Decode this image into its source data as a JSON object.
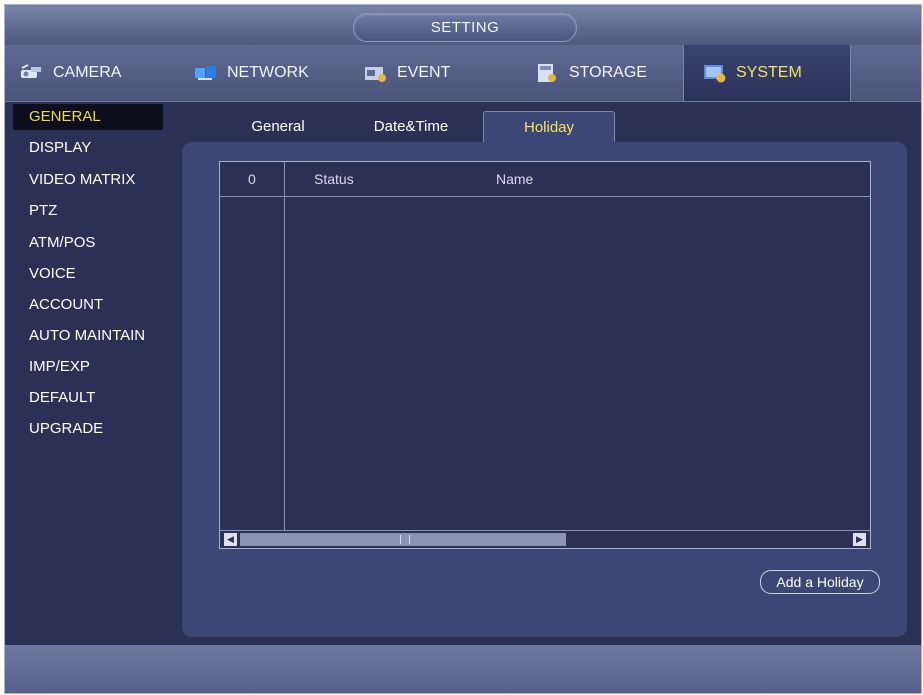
{
  "window": {
    "title": "SETTING"
  },
  "topnav": {
    "tabs": [
      {
        "label": "CAMERA",
        "icon": "camera-icon"
      },
      {
        "label": "NETWORK",
        "icon": "network-icon"
      },
      {
        "label": "EVENT",
        "icon": "event-icon"
      },
      {
        "label": "STORAGE",
        "icon": "storage-icon"
      },
      {
        "label": "SYSTEM",
        "icon": "system-icon",
        "active": true
      }
    ]
  },
  "sidebar": {
    "items": [
      {
        "label": "GENERAL",
        "active": true
      },
      {
        "label": "DISPLAY"
      },
      {
        "label": "VIDEO MATRIX"
      },
      {
        "label": "PTZ"
      },
      {
        "label": "ATM/POS"
      },
      {
        "label": "VOICE"
      },
      {
        "label": "ACCOUNT"
      },
      {
        "label": "AUTO MAINTAIN"
      },
      {
        "label": "IMP/EXP"
      },
      {
        "label": "DEFAULT"
      },
      {
        "label": "UPGRADE"
      }
    ]
  },
  "subtabs": [
    {
      "label": "General"
    },
    {
      "label": "Date&Time"
    },
    {
      "label": "Holiday",
      "active": true
    }
  ],
  "table": {
    "columns": [
      "0",
      "Status",
      "Name"
    ],
    "rows": []
  },
  "actions": {
    "add_holiday": "Add a Holiday"
  },
  "colors": {
    "accent": "#f2db4e",
    "background": "#2b3154",
    "panel": "#3d4775"
  }
}
